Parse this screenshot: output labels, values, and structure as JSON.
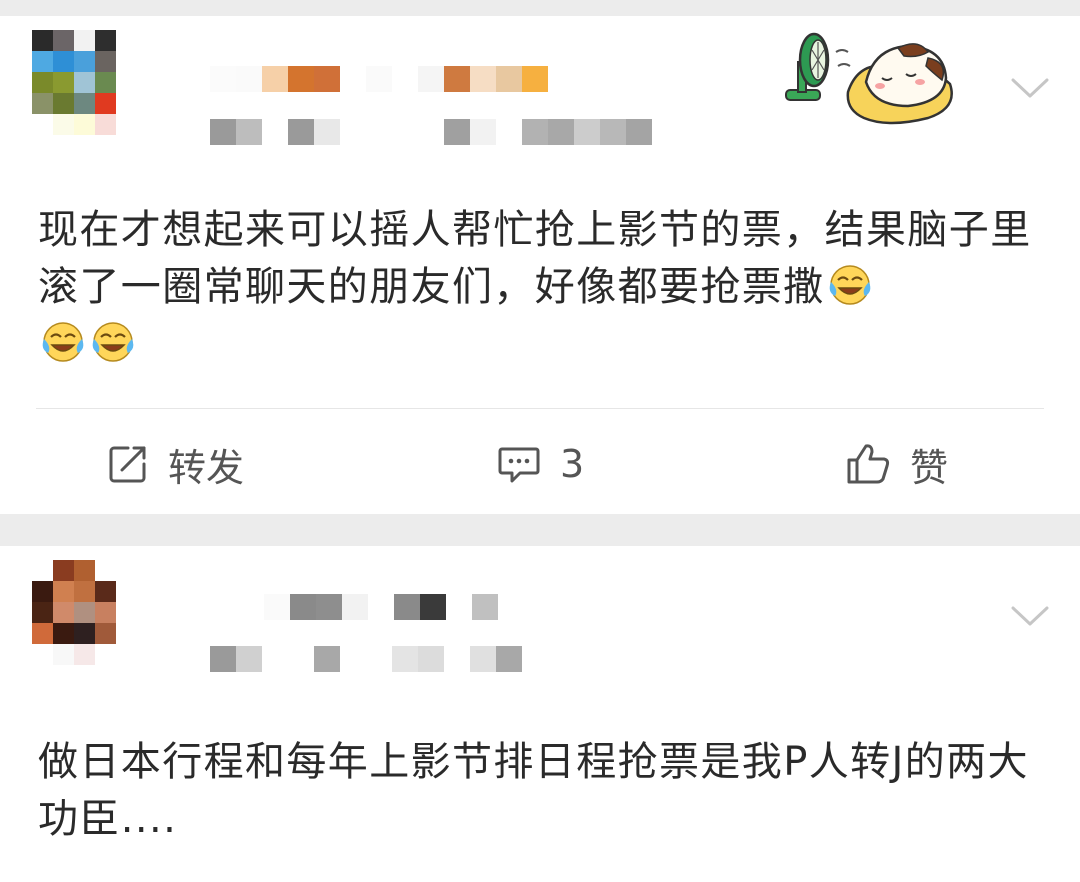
{
  "posts": [
    {
      "text": "现在才想起来可以摇人帮忙抢上影节的票，结果脑子里滚了一圈常聊天的朋友们，好像都要抢票撒",
      "emoji_count": 3,
      "actions": {
        "repost_label": "转发",
        "comment_count": "3",
        "like_label": "赞"
      }
    },
    {
      "text": "做日本行程和每年上影节排日程抢票是我P人转J的两大功臣...."
    }
  ],
  "icons": {
    "repost": "share-edit-icon",
    "comment": "comment-bubble-icon",
    "like": "thumbs-up-icon",
    "menu": "chevron-down-icon",
    "emoji": "laugh-cry-emoji-icon",
    "sticker": "fan-sleeping-sticker"
  },
  "colors": {
    "page_bg": "#ececec",
    "card_bg": "#ffffff",
    "text": "#2a2a2a",
    "action_text": "#555555"
  }
}
